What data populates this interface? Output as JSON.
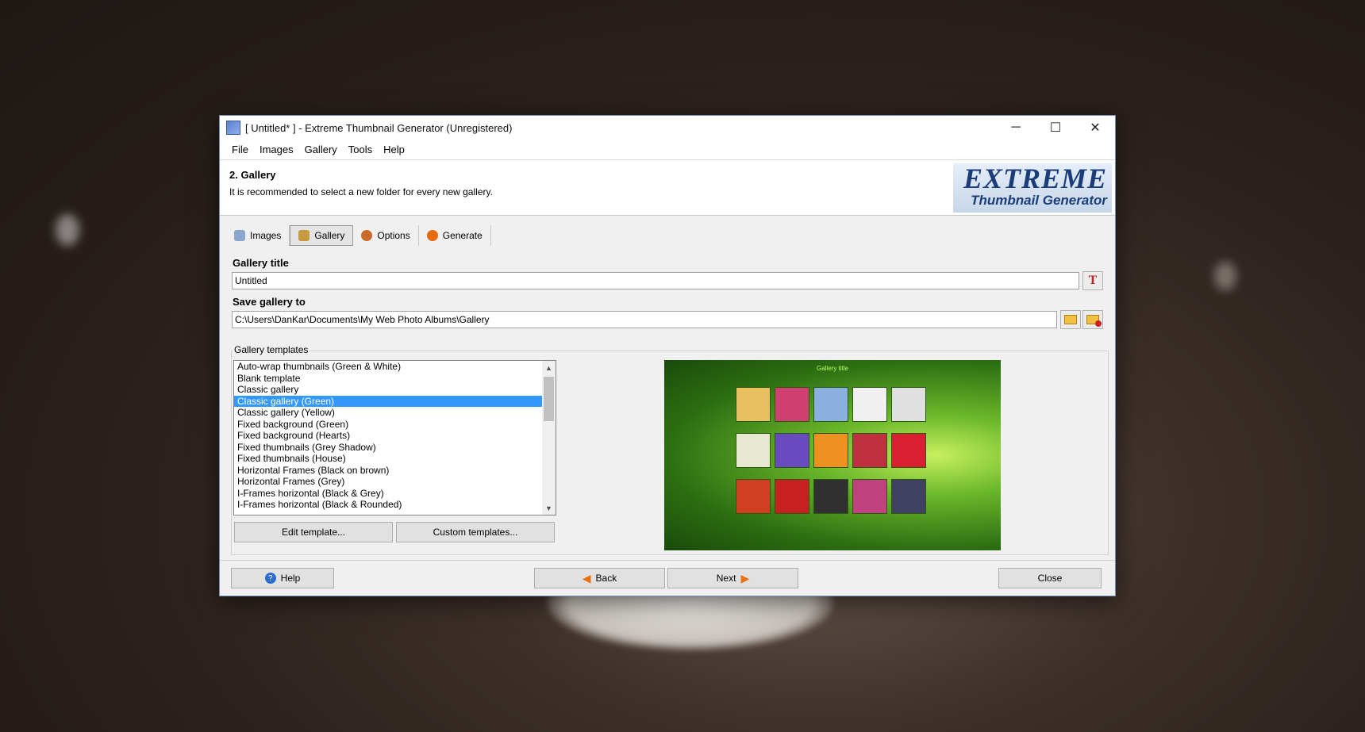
{
  "window": {
    "title": "[ Untitled* ] - Extreme Thumbnail Generator (Unregistered)",
    "controls": {
      "minimize": "─",
      "maximize": "☐",
      "close": "✕"
    }
  },
  "menu": [
    "File",
    "Images",
    "Gallery",
    "Tools",
    "Help"
  ],
  "header": {
    "title": "2. Gallery",
    "subtitle": "It is recommended to select a new folder for every new gallery.",
    "logo_line1": "EXTREME",
    "logo_line2": "Thumbnail Generator"
  },
  "tabs": [
    {
      "label": "Images",
      "icon": "images-icon",
      "color": "#8aa6cc"
    },
    {
      "label": "Gallery",
      "icon": "gallery-icon",
      "color": "#c89a40"
    },
    {
      "label": "Options",
      "icon": "options-icon",
      "color": "#c86a2a"
    },
    {
      "label": "Generate",
      "icon": "generate-icon",
      "color": "#e86a10"
    }
  ],
  "gallery_title": {
    "label": "Gallery title",
    "value": "Untitled"
  },
  "save_gallery": {
    "label": "Save gallery to",
    "value": "C:\\Users\\DanKar\\Documents\\My Web Photo Albums\\Gallery"
  },
  "templates": {
    "label": "Gallery templates",
    "items": [
      "Auto-wrap thumbnails (Green & White)",
      "Blank template",
      "Classic gallery",
      "Classic gallery (Green)",
      "Classic gallery (Yellow)",
      "Fixed background (Green)",
      "Fixed background (Hearts)",
      "Fixed thumbnails (Grey Shadow)",
      "Fixed thumbnails (House)",
      "Horizontal Frames (Black on brown)",
      "Horizontal Frames (Grey)",
      "I-Frames horizontal (Black & Grey)",
      "I-Frames horizontal (Black & Rounded)"
    ],
    "selected": "Classic gallery (Green)",
    "edit_button": "Edit template...",
    "custom_button": "Custom templates..."
  },
  "preview": {
    "title": "Gallery title",
    "thumb_colors": [
      "#e8c060",
      "#d04070",
      "#8ab0e0",
      "#f0f0f0",
      "#e0e0e0",
      "#e8e8d0",
      "#6a4ac0",
      "#f09020",
      "#c03040",
      "#d82030",
      "#d04020",
      "#c82020",
      "#303030",
      "#c04080",
      "#404060"
    ]
  },
  "footer": {
    "help": "Help",
    "back": "Back",
    "next": "Next",
    "close": "Close"
  }
}
